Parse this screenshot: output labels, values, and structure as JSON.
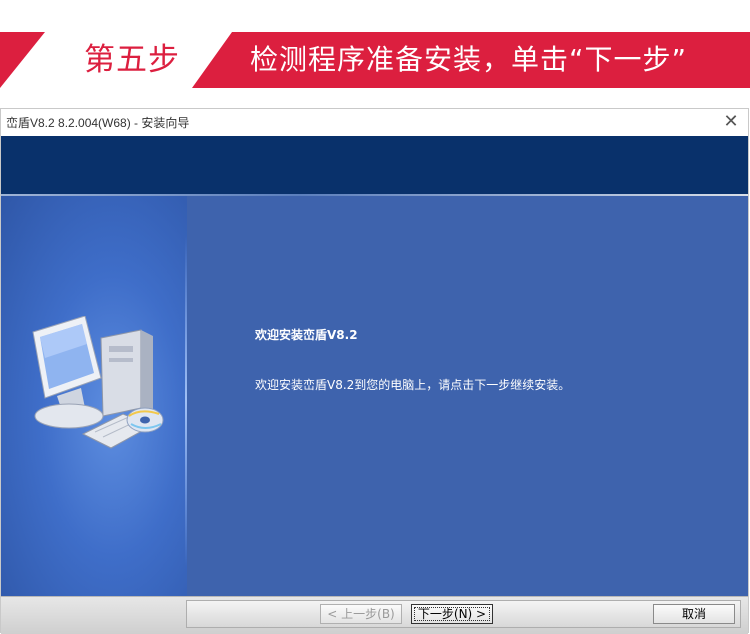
{
  "banner": {
    "step_label": "第五步",
    "title": "检测程序准备安装，单击“下一步”",
    "accent_color": "#dc1f3f"
  },
  "window": {
    "title": "峦盾V8.2 8.2.004(W68) - 安装向导",
    "close_icon": "close-icon"
  },
  "wizard": {
    "welcome_title": "欢迎安装峦盾V8.2",
    "welcome_text": "欢迎安装峦盾V8.2到您的电脑上，请点击下一步继续安装。",
    "illustration": "computer-with-cd-icon"
  },
  "buttons": {
    "back": "< 上一步(B)",
    "next": "下一步(N) >",
    "cancel": "取消"
  }
}
